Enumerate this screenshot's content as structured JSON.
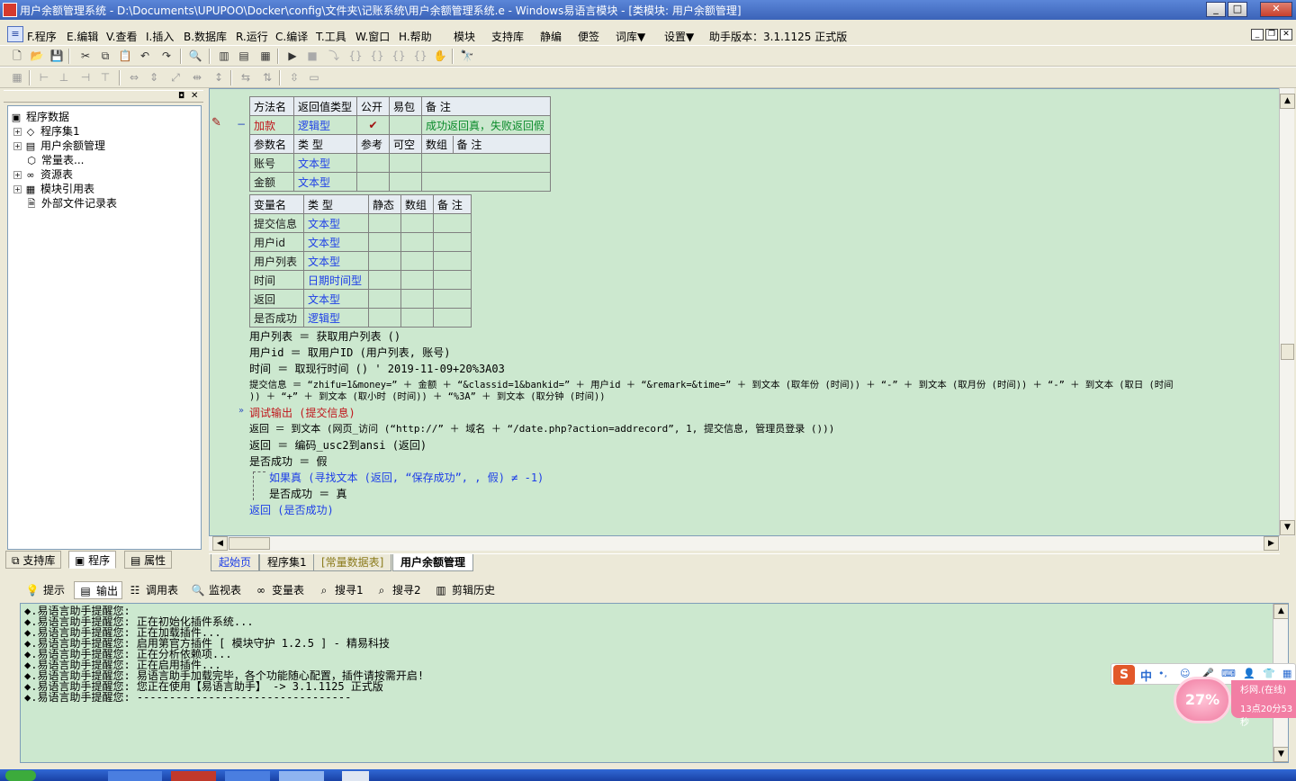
{
  "window": {
    "title": "用户余额管理系统 - D:\\Documents\\UPUPOO\\Docker\\config\\文件夹\\记账系统\\用户余额管理系统.e - Windows易语言模块 - [类模块: 用户余额管理]",
    "buttons": [
      "_",
      "□",
      "✕"
    ]
  },
  "menu": {
    "items": [
      "F.程序",
      "E.编辑",
      "V.查看",
      "I.插入",
      "B.数据库",
      "R.运行",
      "C.编译",
      "T.工具",
      "W.窗口",
      "H.帮助",
      "模块",
      "支持库",
      "静编",
      "便签",
      "词库▼",
      "设置▼",
      "助手版本：3.1.1125 正式版"
    ]
  },
  "tree": {
    "items": [
      {
        "label": "程序数据",
        "icon": "program-data-icon",
        "expand": ""
      },
      {
        "label": "程序集1",
        "icon": "assembly-icon",
        "expand": "+"
      },
      {
        "label": "用户余额管理",
        "icon": "class-module-icon",
        "expand": "+"
      },
      {
        "label": "常量表...",
        "icon": "constant-table-icon",
        "expand": ""
      },
      {
        "label": "资源表",
        "icon": "resource-table-icon",
        "expand": "+"
      },
      {
        "label": "模块引用表",
        "icon": "module-ref-icon",
        "expand": "+"
      },
      {
        "label": "外部文件记录表",
        "icon": "external-file-icon",
        "expand": ""
      }
    ]
  },
  "left_tabs": [
    "支持库",
    "程序",
    "属性"
  ],
  "method_table": {
    "header": [
      "方法名",
      "返回值类型",
      "公开",
      "易包",
      "备 注"
    ],
    "row": {
      "name": "加款",
      "type": "逻辑型",
      "public": "✔",
      "easy": "",
      "note": "成功返回真，失败返回假"
    },
    "param_header": [
      "参数名",
      "类 型",
      "参考",
      "可空",
      "数组",
      "备 注"
    ],
    "params": [
      {
        "name": "账号",
        "type": "文本型"
      },
      {
        "name": "金额",
        "type": "文本型"
      }
    ]
  },
  "var_table": {
    "header": [
      "变量名",
      "类 型",
      "静态",
      "数组",
      "备 注"
    ],
    "vars": [
      {
        "name": "提交信息",
        "type": "文本型"
      },
      {
        "name": "用户id",
        "type": "文本型"
      },
      {
        "name": "用户列表",
        "type": "文本型"
      },
      {
        "name": "时间",
        "type": "日期时间型"
      },
      {
        "name": "返回",
        "type": "文本型"
      },
      {
        "name": "是否成功",
        "type": "逻辑型"
      }
    ]
  },
  "code": {
    "l1": "用户列表 ＝ 获取用户列表 ()",
    "l2": "用户id ＝ 取用户ID (用户列表, 账号)",
    "l3": "时间 ＝ 取现行时间 ()  ' 2019-11-09+20%3A03",
    "l4": "提交信息 ＝ “zhifu=1&money=” ＋ 金额 ＋ “&classid=1&bankid=” ＋ 用户id ＋ “&remark=&time=” ＋ 到文本 (取年份 (时间)) ＋ “-” ＋ 到文本 (取月份 (时间)) ＋ “-” ＋ 到文本 (取日 (时间",
    "l5": ")) ＋ “+” ＋ 到文本 (取小时 (时间)) ＋ “%3A” ＋ 到文本 (取分钟 (时间))",
    "l6": "调试输出 (提交信息)",
    "l7": "返回 ＝ 到文本 (网页_访问 (“http://” ＋ 域名 ＋ “/date.php?action=addrecord”, 1, 提交信息, 管理员登录 ()))",
    "l8": "返回 ＝ 编码_usc2到ansi (返回)",
    "l9": "是否成功 ＝ 假",
    "l10": "如果真 (寻找文本 (返回, “保存成功”, , 假) ≠ -1)",
    "l11": "是否成功 ＝ 真",
    "l12": "返回 (是否成功)"
  },
  "doc_tabs": [
    "起始页",
    "程序集1",
    "[常量数据表]",
    "用户余额管理"
  ],
  "bottom_tabs": [
    "提示",
    "输出",
    "调用表",
    "监视表",
    "变量表",
    "搜寻1",
    "搜寻2",
    "剪辑历史"
  ],
  "output": {
    "lines": [
      "◆.易语言助手提醒您:",
      "◆.易语言助手提醒您: 正在初始化插件系统...",
      "◆.易语言助手提醒您: 正在加载插件...",
      "◆.易语言助手提醒您: 启用第官方插件 [ 模块守护 1.2.5 ] - 精易科技",
      "◆.易语言助手提醒您: 正在分析依赖项...",
      "◆.易语言助手提醒您: 正在启用插件...",
      "◆.易语言助手提醒您: 易语言助手加载完毕，各个功能随心配置，插件请按需开启!",
      "◆.易语言助手提醒您: 您正在使用【易语言助手】 ->  3.1.1125 正式版",
      "◆.易语言助手提醒您: ---------------------------------"
    ]
  },
  "ime": {
    "logo": "S",
    "mode": "中"
  },
  "bubble": {
    "percent": "27%",
    "line1": "杉网.(在线)",
    "line2": "13点20分53秒"
  },
  "colors": {
    "editor_bg": "#cce8cf",
    "keyword_blue": "#1d3ee8",
    "func_red": "#c0151b",
    "comment_green": "#0a8a2a"
  }
}
